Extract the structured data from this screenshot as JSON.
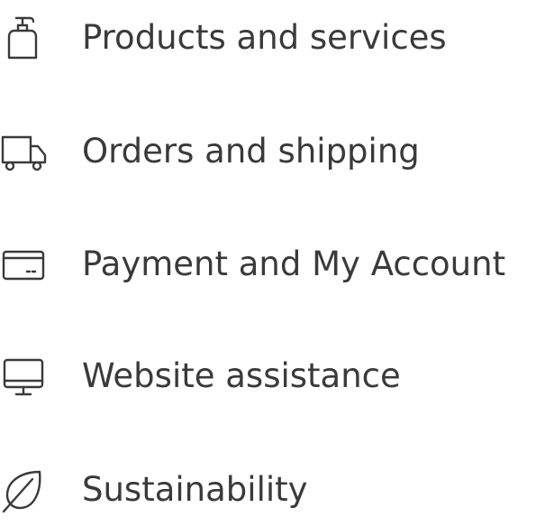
{
  "menu": {
    "items": [
      {
        "label": "Products and services",
        "icon": "soap-dispenser-icon"
      },
      {
        "label": "Orders and shipping",
        "icon": "delivery-truck-icon"
      },
      {
        "label": "Payment and My Account",
        "icon": "credit-card-icon"
      },
      {
        "label": "Website assistance",
        "icon": "monitor-icon"
      },
      {
        "label": "Sustainability",
        "icon": "leaf-icon"
      }
    ]
  },
  "colors": {
    "text": "#3a3a3a",
    "icon_stroke": "#3a3a3a",
    "background": "#ffffff"
  }
}
